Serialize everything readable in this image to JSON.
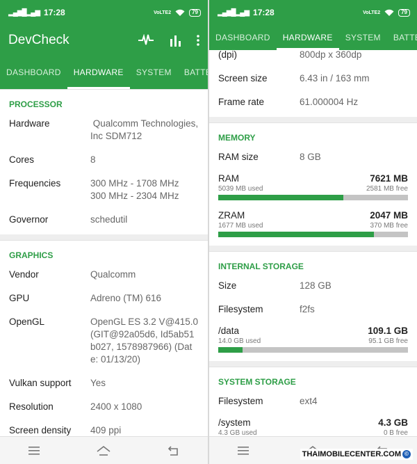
{
  "status": {
    "time": "17:28",
    "signal": "4G",
    "volte": "VoLTE2",
    "battery": "79"
  },
  "left": {
    "app_title": "DevCheck",
    "tabs": [
      "DASHBOARD",
      "HARDWARE",
      "SYSTEM",
      "BATTERY"
    ],
    "processor": {
      "title": "PROCESSOR",
      "rows": [
        {
          "k": "Hardware",
          "v": " Qualcomm Technologies, Inc SDM712"
        },
        {
          "k": "Cores",
          "v": "8"
        },
        {
          "k": "Frequencies",
          "v": "300 MHz - 1708 MHz\n300 MHz - 2304 MHz"
        },
        {
          "k": "Governor",
          "v": "schedutil"
        }
      ]
    },
    "graphics": {
      "title": "GRAPHICS",
      "rows": [
        {
          "k": "Vendor",
          "v": "Qualcomm"
        },
        {
          "k": "GPU",
          "v": "Adreno (TM) 616"
        },
        {
          "k": "OpenGL",
          "v": "OpenGL ES 3.2 V@415.0 (GIT@92a05d6, Id5ab51b027, 1578987966) (Date: 01/13/20)"
        },
        {
          "k": "Vulkan support",
          "v": "Yes"
        },
        {
          "k": "Resolution",
          "v": "2400 x 1080"
        },
        {
          "k": "Screen density",
          "v": "409 ppi"
        }
      ]
    }
  },
  "right": {
    "tabs": [
      "DASHBOARD",
      "HARDWARE",
      "SYSTEM",
      "BATTERY"
    ],
    "display_rows": [
      {
        "k": "(dpi)",
        "v": "800dp x 360dp"
      },
      {
        "k": "Screen size",
        "v": "6.43 in / 163 mm"
      },
      {
        "k": "Frame rate",
        "v": "61.000004 Hz"
      }
    ],
    "memory": {
      "title": "MEMORY",
      "ram_size": {
        "k": "RAM size",
        "v": "8 GB"
      },
      "meters": [
        {
          "label": "RAM",
          "total": "7621 MB",
          "used": "5039 MB used",
          "free": "2581 MB free",
          "fraction": 0.661
        },
        {
          "label": "ZRAM",
          "total": "2047 MB",
          "used": "1677 MB used",
          "free": "370 MB free",
          "fraction": 0.819
        }
      ]
    },
    "internal": {
      "title": "INTERNAL STORAGE",
      "rows": [
        {
          "k": "Size",
          "v": "128 GB"
        },
        {
          "k": "Filesystem",
          "v": "f2fs"
        }
      ],
      "meter": {
        "label": "/data",
        "total": "109.1 GB",
        "used": "14.0 GB used",
        "free": "95.1 GB free",
        "fraction": 0.128
      }
    },
    "system": {
      "title": "SYSTEM STORAGE",
      "rows": [
        {
          "k": "Filesystem",
          "v": "ext4"
        }
      ],
      "meter": {
        "label": "/system",
        "total": "4.3 GB",
        "used": "4.3 GB used",
        "free": "0 B free",
        "fraction": 1.0
      }
    }
  },
  "watermark": "THAIMOBILECENTER.COM",
  "colors": {
    "accent": "#2e9e47",
    "bar_bg": "#c4c4c4",
    "section_gap": "#eeeeee"
  }
}
